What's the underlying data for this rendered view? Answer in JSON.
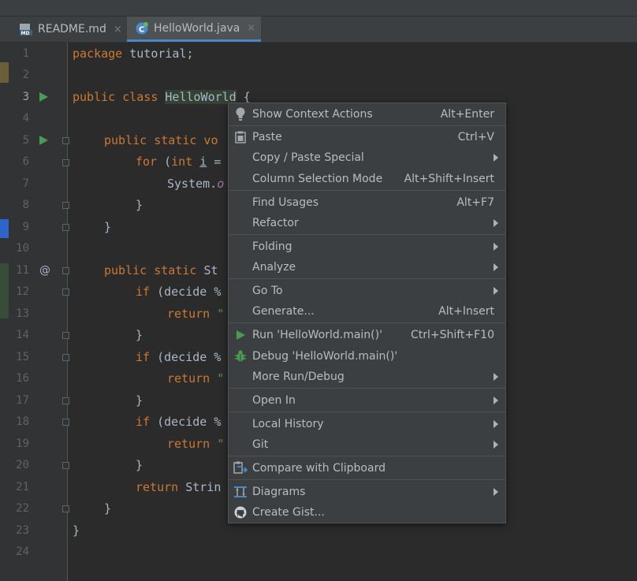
{
  "tabs": [
    {
      "label": "README.md",
      "icon": "markdown-file-icon",
      "close": "×"
    },
    {
      "label": "HelloWorld.java",
      "icon": "java-class-icon",
      "close": "×"
    }
  ],
  "editor": {
    "line_numbers": [
      "1",
      "2",
      "3",
      "4",
      "5",
      "6",
      "7",
      "8",
      "9",
      "10",
      "11",
      "12",
      "13",
      "14",
      "15",
      "16",
      "17",
      "18",
      "19",
      "20",
      "21",
      "22",
      "23",
      "24"
    ],
    "code": {
      "l1_kw": "package ",
      "l1_rest": "tutorial;",
      "l3_kw": "public class ",
      "l3_class": "HelloWorld",
      "l3_rest": " {",
      "l5_kw": "public static vo",
      "l6_kw": "for ",
      "l6_a": "(",
      "l6_kw2": "int ",
      "l6_var": "i",
      "l6_b": " =",
      "l7_a": "System.",
      "l7_b": "o",
      "brace_close": "}",
      "l11_kw": "public static ",
      "l11_rest": "St",
      "if_kw": "if ",
      "if_rest": "(decide %",
      "return_kw": "return ",
      "return_rest": "\"",
      "l21_kw": "return ",
      "l21_rest": "Strin"
    },
    "gutter_at": "@"
  },
  "context_menu": {
    "items": [
      {
        "label": "Show Context Actions",
        "shortcut": "Alt+Enter",
        "icon": "lightbulb-icon"
      },
      {
        "label": "Paste",
        "shortcut": "Ctrl+V",
        "icon": "clipboard-paste-icon"
      },
      {
        "label": "Copy / Paste Special",
        "submenu": true
      },
      {
        "label": "Column Selection Mode",
        "shortcut": "Alt+Shift+Insert"
      },
      {
        "label": "Find Usages",
        "shortcut": "Alt+F7"
      },
      {
        "label": "Refactor",
        "submenu": true
      },
      {
        "label": "Folding",
        "submenu": true
      },
      {
        "label": "Analyze",
        "submenu": true
      },
      {
        "label": "Go To",
        "submenu": true
      },
      {
        "label": "Generate...",
        "shortcut": "Alt+Insert"
      },
      {
        "label": "Run 'HelloWorld.main()'",
        "shortcut": "Ctrl+Shift+F10",
        "icon": "run-icon"
      },
      {
        "label": "Debug 'HelloWorld.main()'",
        "icon": "debug-icon"
      },
      {
        "label": "More Run/Debug",
        "submenu": true
      },
      {
        "label": "Open In",
        "submenu": true
      },
      {
        "label": "Local History",
        "submenu": true
      },
      {
        "label": "Git",
        "submenu": true
      },
      {
        "label": "Compare with Clipboard",
        "icon": "compare-icon"
      },
      {
        "label": "Diagrams",
        "submenu": true,
        "icon": "diagram-icon"
      },
      {
        "label": "Create Gist...",
        "icon": "github-icon"
      }
    ]
  },
  "colors": {
    "keyword": "#cc7832",
    "text": "#a9b7c6",
    "string": "#6a8759",
    "run_green": "#499c54",
    "menu_bg": "#3c3f41",
    "editor_bg": "#2b2b2b"
  }
}
